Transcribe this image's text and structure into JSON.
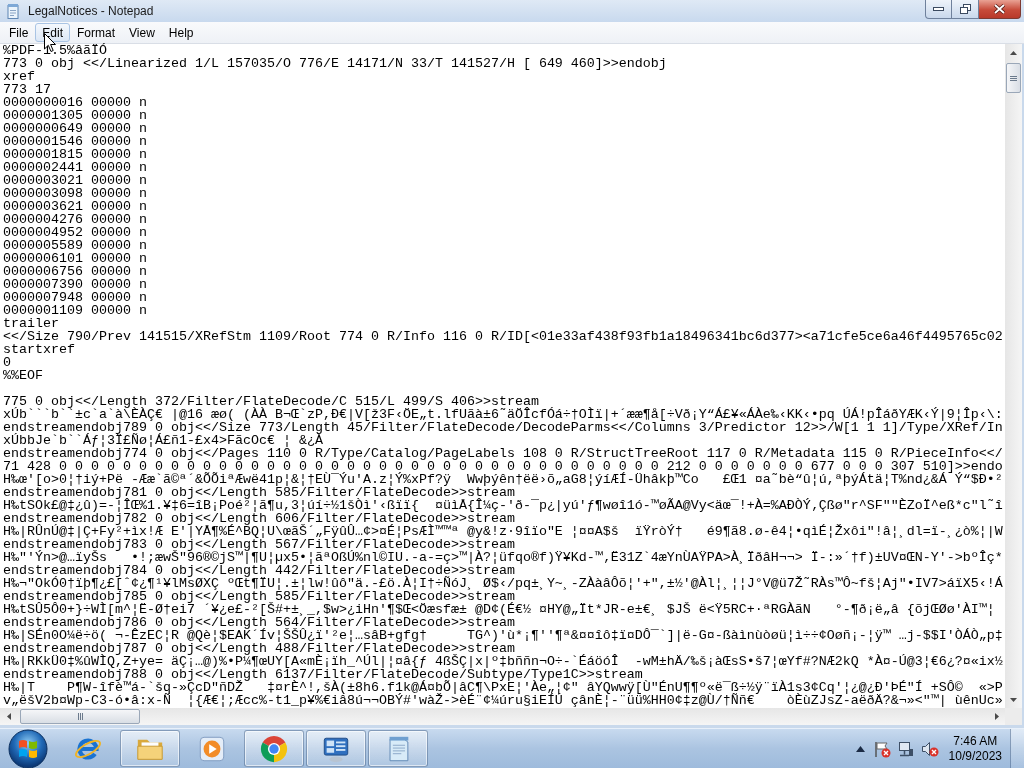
{
  "window": {
    "title": "LegalNotices - Notepad"
  },
  "menu": [
    {
      "label": "File",
      "highlighted": false
    },
    {
      "label": "Edit",
      "highlighted": true
    },
    {
      "label": "Format",
      "highlighted": false
    },
    {
      "label": "View",
      "highlighted": false
    },
    {
      "label": "Help",
      "highlighted": false
    }
  ],
  "document": {
    "blocks": [
      [
        "%PDF-1.5%âãÏÓ",
        "773 0 obj <</Linearized 1/L 157035/O 776/E 14171/N 33/T 141527/H [ 649 460]>>endobj",
        "xref",
        "773 17",
        "0000000016 00000 n",
        "0000001305 00000 n",
        "0000000649 00000 n",
        "0000001546 00000 n",
        "0000001815 00000 n",
        "0000002441 00000 n",
        "0000003021 00000 n",
        "0000003098 00000 n",
        "0000003621 00000 n",
        "0000004276 00000 n",
        "0000004952 00000 n",
        "0000005589 00000 n",
        "0000006101 00000 n",
        "0000006756 00000 n",
        "0000007390 00000 n",
        "0000007948 00000 n",
        "0000001109 00000 n",
        "trailer",
        "<</Size 790/Prev 141515/XRefStm 1109/Root 774 0 R/Info 116 0 R/ID[<01e33af438f93fb1a18496341bc6d377><a71cfe5ce6a46f4495765c02",
        "startxref",
        "0",
        "%%EOF"
      ],
      [
        "775 0 obj<</Length 372/Filter/FlateDecode/C 515/L 499/S 406>>stream",
        "xÚb```b``±c`a`à\\ÈÀÇ€ |@16 æø( (ÀÀ B¬Œ`zP,Ð€|V[ž3F‹ÖE„t.lfUãà±6˜äÖÎcfÓá÷†OÌï|+´ææ¶å[÷Vð¡Y“Á£¥«ÁÀe‰‹KK‹•pq ÚÁ!pÎáðYÆK‹Ý|9¦Îp‹\\:",
        "endstreamendobj789 0 obj<</Size 773/Length 45/Filter/FlateDecode/DecodeParms<</Columns 3/Predictor 12>>/W[1 1 1]/Type/XRef/In",
        "xÚbbJe`b``Áƒ¦3Ï£Ñø¦Á£ñ1-£x4>FãcOc€ ¦ &¿À",
        "endstreamendobj774 0 obj<</Pages 110 0 R/Type/Catalog/PageLabels 108 0 R/StructTreeRoot 117 0 R/Metadata 115 0 R/PieceInfo<</",
        "71 428 0 0 0 0 0 0 0 0 0 0 0 0 0 0 0 0 0 0 0 0 0 0 0 0 0 0 0 0 0 0 0 0 0 0 0 0 0 0 212 0 0 0 0 0 0 0 677 0 0 0 307 510]>>endo",
        "H‰œ'[o>0¦†iý+Pë -Ææ`ã©ª´&ÕÕiªÆwë41p¦&¦†EÙ¯Ýu'A.z¦Ý%xPf?ÿ  Wwþýên†ëë›õ„aG8¦ýíÆÍ-Ühâkþ™Co   £Œ1 ¤a˜bè“û¦ú,ªþýÁtä¦T%nd¿&Á Ý“$Ð•²",
        "endstreamendobj781 0 obj<</Length 585/Filter/FlateDecode>>stream",
        "H‰tSOk£@‡¿û)=-¦ÎŒ%1.¥‡6=îB¡Poé²¦ã¶u,3¦úí÷½1šÒì'‹ßïï{  ¤üìÅ{Î¼ç-'ð-¯p¿|yú'ƒ¶wøî1ó-™øÃA@Vy<äœ¯!+À=%AÐÒÝ‚Çßø\"r^SF\"\"ÈZoÏ^eß*c\"l˜î",
        "endstreamendobj782 0 obj<</Length 606/Filter/FlateDecode>>stream",
        "H‰|RÛnÚ@‡|Ç+Fy²+ìx!Æ E'|YÅ¶%É^BQ¦U\\œãŠ´„FÿûÛ…¢>¤É¦PsÆÌ™™ª @y&!z·9îïo\"E ¦¤¤A$š  ïŸròÝ†   é9¶ã8.ø-ê4¦•qìÉ¦Žxôi\"!â¦¸dl=ï-¸¿ò%¦|W",
        "endstreamendobj783 0 obj<</Length 567/Filter/FlateDecode>>stream",
        "H‰\"'Ýn>@…ïyŠs   •!;æwŠ\"96®©jS™|¶U¦µx5•¦ãªOßÚ%nl©IU.-a-=ç>™|À?¦üfqo®f)Ÿ¥Kd-™‚Ë31Z`4æYnÙAŸPA>À¸ÏðâH¬¬> Ï-:»´†f)±UV¤ŒN-Y'->bºÎç*",
        "endstreamendobj784 0 obj<</Length 442/Filter/FlateDecode>>stream",
        "H‰¬\"OkÓ0†ïþ¶¿£[ˆ¢¿¶¹¥lMsØXÇ ºŒt¶ÏU¦.±¦lw!ûô\"ä.-£ö.À¦I†÷ÑóJ¸ Ø$‹/pq±¸Y~¸-ZÀàâÔõ¦'+\",±½'@Àl¦¸¦¦J°V@ü7Ž˜RÀs™Ô~fš¦Aj\"•IV7>áïX5‹!Á",
        "endstreamendobj785 0 obj<</Length 585/Filter/FlateDecode>>stream",
        "H‰tSÛ5Ô0+}÷WÌ[m^¦Ë-Ø†ei7 ´¥¿e£-²[Š#+±¸_,$w>¿iHn'¶$Œ<Öæsfæ± @D¢(É€½ ¤HY@„Ït*JR-e±€¸ $JŠ ë<Ÿ5RC+·ªRGÀãN   °-¶ð¡ë„â {õjŒØø'ÀI™¦",
        "endstreamendobj786 0 obj<</Length 564/Filter/FlateDecode>>stream",
        "H‰|SÉn0O¼ë÷ö( ¬-ÊzEC¦R @Qè¦$EAK´Ív¦ŠŠÛ¿ï'²e¦…sâB+gfg†     TG^)'ù*¡¶''¶ª&¤¤îô‡ï¤DÔ¯`]|ë-G¤-ßàìnùòøü¦ì÷÷¢Oøñ¡-¦ÿ™ …j-$$I'ÒÁÒ„p‡",
        "endstreamendobj787 0 obj<</Length 488/Filter/FlateDecode>>stream",
        "H‰|RKkÜ0‡%ûWÌQ,Z+ye= äÇ¡…@)%•P¼¶œUY[A«mÈ¡ïh_^Úl|¦¤â{ƒ 4ßŠÇ|x|º‡bññn¬O÷-`ÉáöóÎ  -wM±hÄ/‰š¡àŒsS•š7¦œYf#?NÆ2kQ *À¤-Ú@3¦€6¿?¤«ix½",
        "endstreamendobj788 0 obj<</Length 6137/Filter/FlateDecode/Subtype/Type1C>>stream",
        "H‰|T    P¶W-îfè™á-`šq-»ÇcD\"ñDŽ   ‡¤rÈ^!,šÀ(±8h6.f1k@Á¤bÕ|âC¶\\PxE¦'Àe„¦¢\" âYQwwÿ[Ù\"ÉnU¶¶º«ë¯ß÷½ÿ¨ïÀ1s3¢Cq'¦¿@¿Ð'ÞÉ\"Í +SÔ©  «>P",
        "v„ëšV2b¤Wp-C3-ó•â:x-Ñ  ¦{Æ€¦;Æcc%-t1_p¥%€iâ8ú¬¬OBÝ#'wàŽ->èÉ¨¢¼úru§iEÍÚ çânÈ¦-¨üü%HH0¢‡z@Ù/†Ññ€    òÈùZJsZ-aëðÄ?&¬»<\"™| ùênUc»"
      ]
    ]
  },
  "taskbar": {
    "apps": [
      {
        "kind": "browser",
        "running": false
      },
      {
        "kind": "folder",
        "running": true
      },
      {
        "kind": "player",
        "running": false
      },
      {
        "kind": "ball",
        "running": true
      },
      {
        "kind": "panel",
        "running": true
      },
      {
        "kind": "notepad",
        "running": true
      }
    ],
    "clock": {
      "time": "7:46 AM",
      "date": "10/9/2023"
    }
  }
}
